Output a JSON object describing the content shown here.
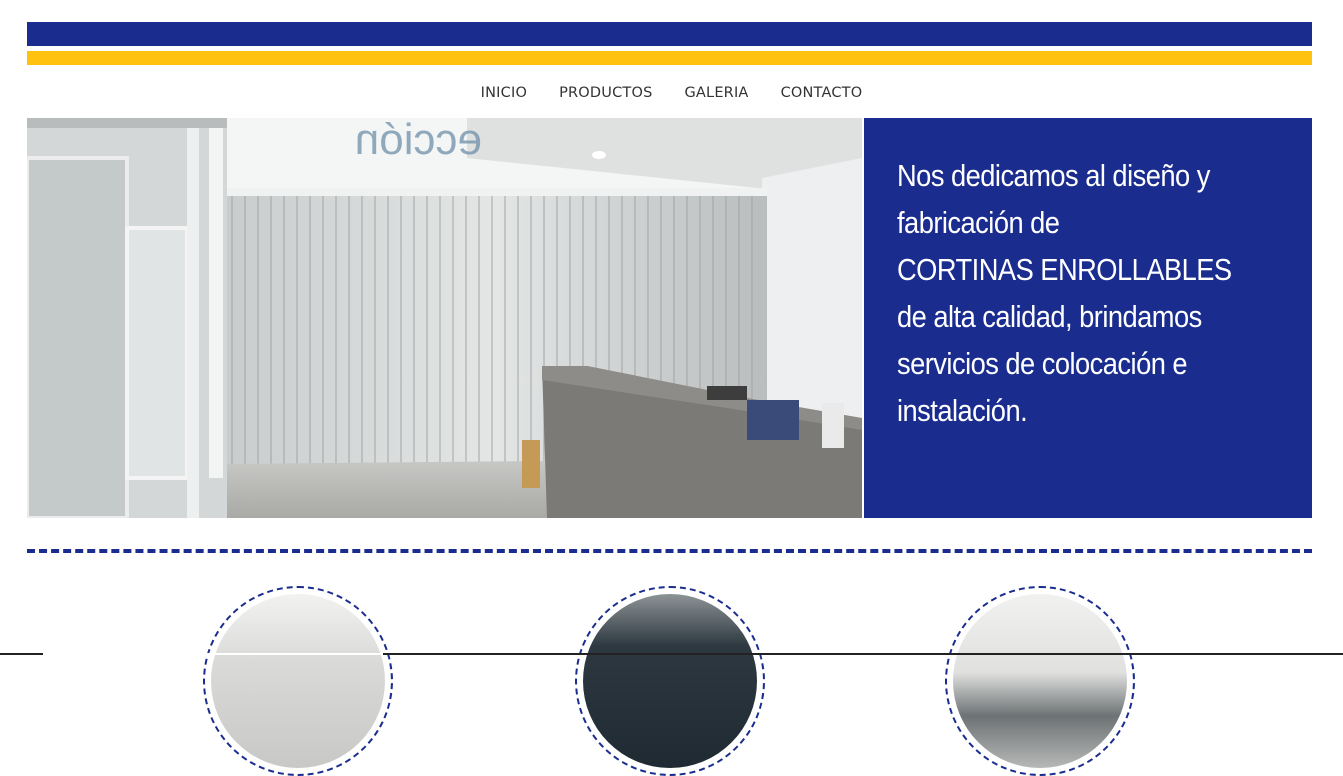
{
  "brand": {
    "primary_color": "#1a2d8f",
    "accent_color": "#ffc20e"
  },
  "nav": {
    "items": [
      {
        "label": "INICIO"
      },
      {
        "label": "PRODUCTOS"
      },
      {
        "label": "GALERIA"
      },
      {
        "label": "CONTACTO"
      }
    ]
  },
  "hero": {
    "image_text": "ección",
    "lines": [
      "Nos dedicamos al diseño y",
      "fabricación de",
      "CORTINAS ENROLLABLES",
      "de alta calidad, brindamos",
      "servicios de colocación e",
      "instalación."
    ]
  },
  "features": [
    {
      "name": "ceiling-photo"
    },
    {
      "name": "dark-curtain-photo"
    },
    {
      "name": "office-curtain-photo"
    }
  ]
}
